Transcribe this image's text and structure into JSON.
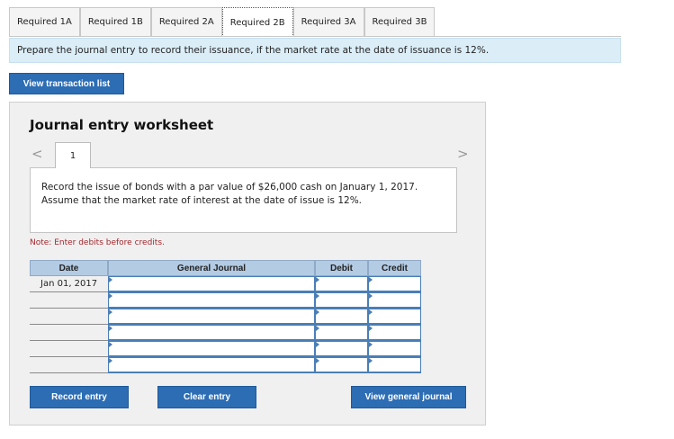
{
  "tabs": [
    "Required 1A",
    "Required 1B",
    "Required 2A",
    "Required 2B",
    "Required 3A",
    "Required 3B"
  ],
  "active_tab_index": 3,
  "instruction": "Prepare the journal entry to record their issuance, if the market rate at the date of issuance is 12%.",
  "view_transaction_list": "View transaction list",
  "worksheet": {
    "title": "Journal entry worksheet",
    "arrow_left": "<",
    "arrow_right": ">",
    "step": "1",
    "description": "Record the issue of bonds with a par value of $26,000 cash on January 1, 2017. Assume that the market rate of interest at the date of issue is 12%.",
    "note": "Note: Enter debits before credits."
  },
  "journal": {
    "headers": {
      "date": "Date",
      "general_journal": "General Journal",
      "debit": "Debit",
      "credit": "Credit"
    },
    "rows": [
      {
        "date": "Jan 01, 2017"
      },
      {
        "date": ""
      },
      {
        "date": ""
      },
      {
        "date": ""
      },
      {
        "date": ""
      },
      {
        "date": ""
      }
    ]
  },
  "buttons": {
    "record_entry": "Record entry",
    "clear_entry": "Clear entry",
    "view_general_journal": "View general journal"
  },
  "colors": {
    "button_blue": "#2c6db4",
    "instruction_bg": "#dbeef8",
    "table_header_bg": "#b3cbe3",
    "note_red": "#a4262c"
  }
}
